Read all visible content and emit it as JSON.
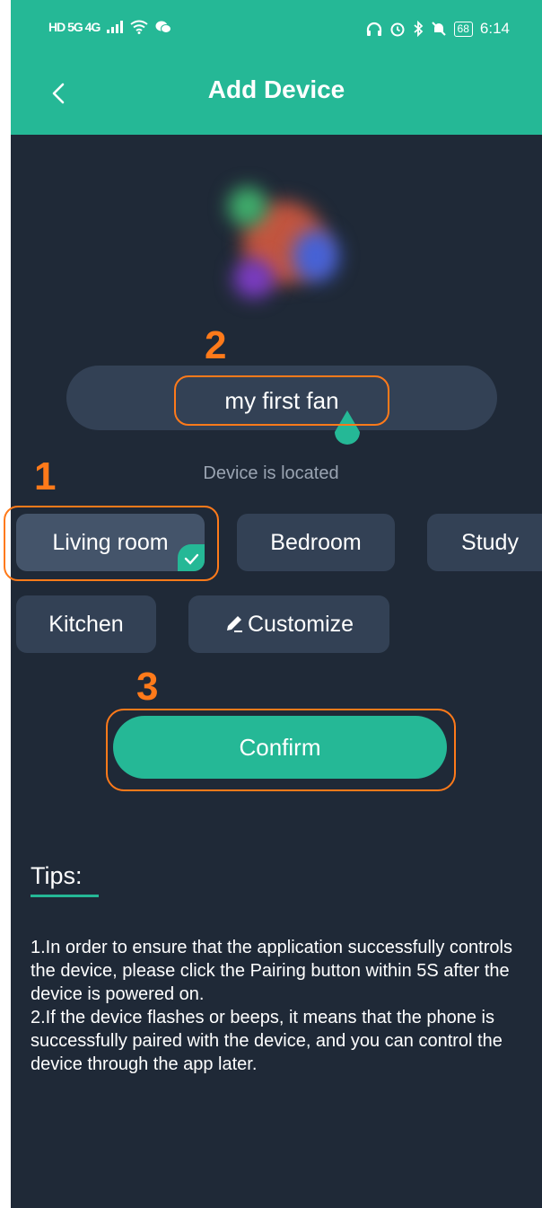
{
  "status_bar": {
    "network_left": "HD 5G 4G",
    "battery": "68",
    "time": "6:14"
  },
  "header": {
    "title": "Add Device",
    "back_icon": "chevron-left-icon"
  },
  "device": {
    "name": "my first fan",
    "located_label": "Device is located"
  },
  "rooms": {
    "items": [
      {
        "label": "Living room",
        "selected": true
      },
      {
        "label": "Bedroom",
        "selected": false
      },
      {
        "label": "Study",
        "selected": false
      },
      {
        "label": "Kitchen",
        "selected": false
      },
      {
        "label": "Customize",
        "selected": false
      }
    ],
    "customize_icon": "pencil-icon"
  },
  "confirm_label": "Confirm",
  "annotations": {
    "step1": "1",
    "step2": "2",
    "step3": "3"
  },
  "tips": {
    "title": "Tips:",
    "line1": "1.In order to ensure that the application successfully controls the device, please click the Pairing button within 5S after the device is powered on.",
    "line2": "2.If the device flashes or beeps, it means that the phone is successfully paired with the device, and you can control the device through the app later."
  },
  "colors": {
    "accent": "#25b896",
    "background": "#1f2937",
    "annotation": "#ff7a1a"
  }
}
